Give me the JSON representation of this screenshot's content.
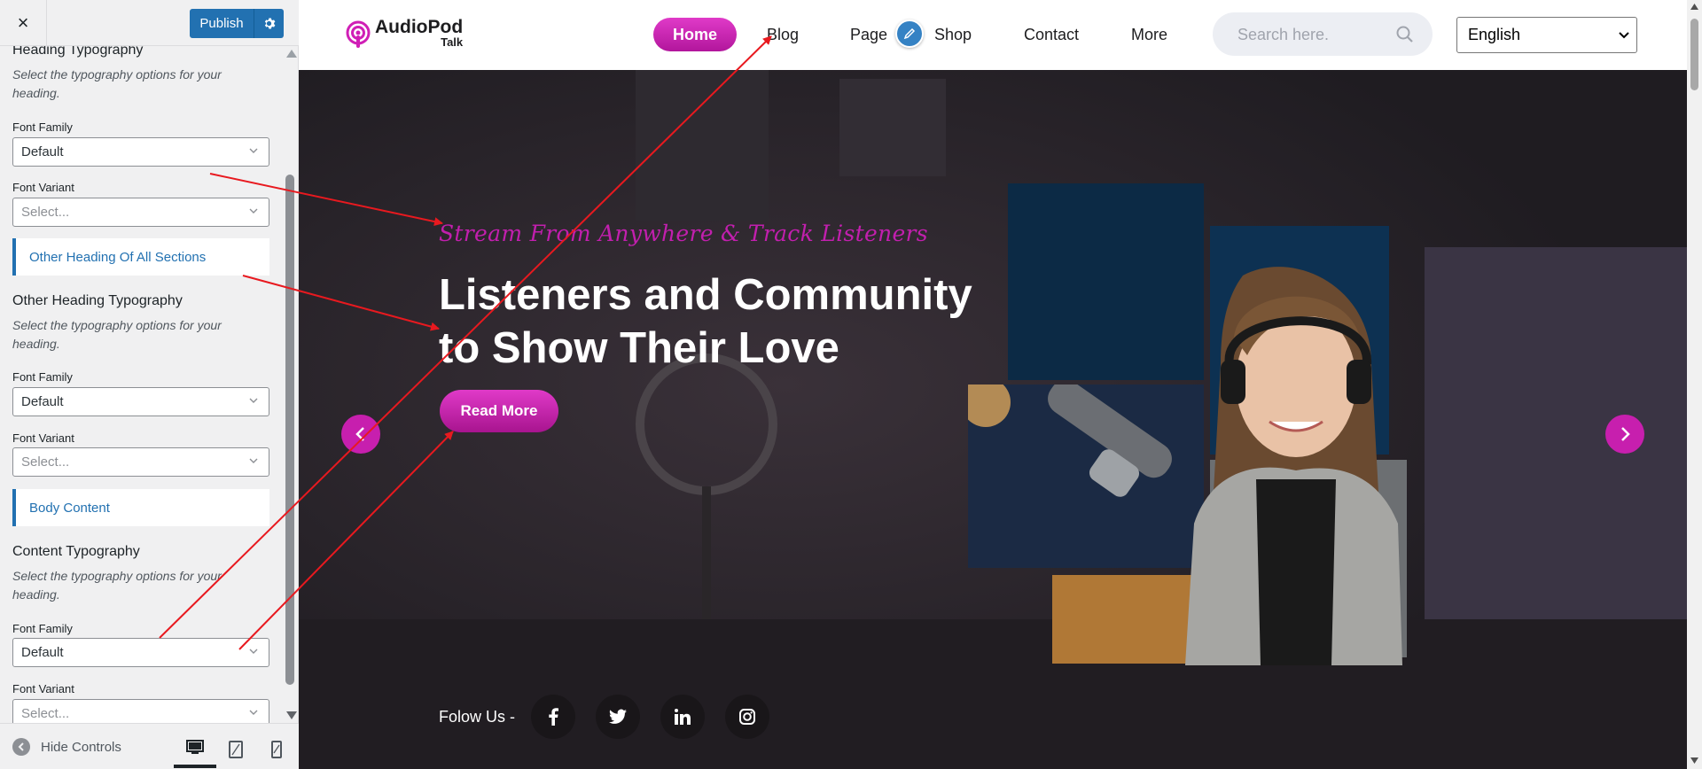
{
  "customizer": {
    "close_label": "×",
    "publish_label": "Publish",
    "sections": {
      "heading": {
        "title": "Heading Typography",
        "description": "Select the typography options for your heading.",
        "font_family_label": "Font Family",
        "font_family_value": "Default",
        "font_variant_label": "Font Variant",
        "font_variant_placeholder": "Select..."
      },
      "other_heading_bar": "Other Heading Of All Sections",
      "other_heading": {
        "title": "Other Heading Typography",
        "description": "Select the typography options for your heading.",
        "font_family_label": "Font Family",
        "font_family_value": "Default",
        "font_variant_label": "Font Variant",
        "font_variant_placeholder": "Select..."
      },
      "body_bar": "Body Content",
      "content": {
        "title": "Content Typography",
        "description": "Select the typography options for your heading.",
        "font_family_label": "Font Family",
        "font_family_value": "Default",
        "font_variant_label": "Font Variant",
        "font_variant_placeholder": "Select..."
      }
    },
    "footer": {
      "hide_controls": "Hide Controls",
      "devices": [
        "desktop-icon",
        "tablet-icon",
        "mobile-icon"
      ],
      "active_device": "desktop"
    }
  },
  "site": {
    "logo": {
      "name": "AudioPod",
      "sub": "Talk"
    },
    "nav": [
      "Home",
      "Blog",
      "Page",
      "Shop",
      "Contact",
      "More"
    ],
    "active_nav": "Home",
    "search_placeholder": "Search here.",
    "language": "English",
    "hero": {
      "subtitle": "Stream From Anywhere & Track Listeners",
      "title": "Listeners and Community to Show Their Love",
      "button": "Read More",
      "follow_label": "Folow Us -",
      "socials": [
        "facebook-icon",
        "twitter-icon",
        "linkedin-icon",
        "instagram-icon"
      ]
    }
  },
  "colors": {
    "accent": "#c71fae",
    "customizer_blue": "#2271b1",
    "hero_bg": "#282429",
    "annotation_arrow": "#e8191f"
  }
}
